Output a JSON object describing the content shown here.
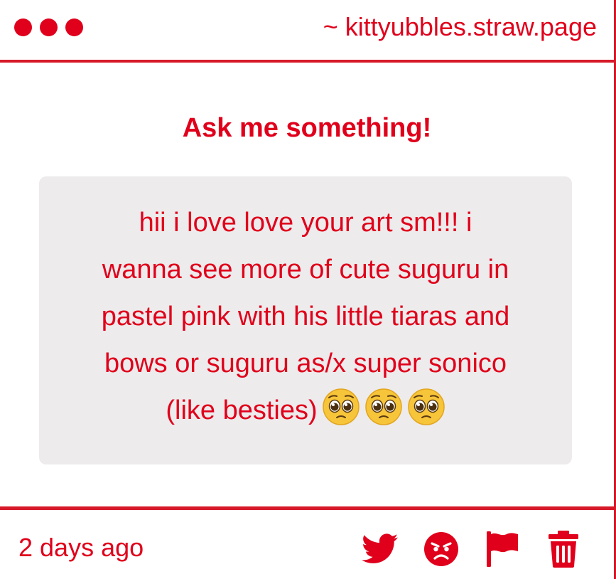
{
  "window": {
    "url_label": "~ kittyubbles.straw.page"
  },
  "main": {
    "heading": "Ask me something!",
    "question_lines": [
      "hii i love love your art sm!!! i",
      "wanna see more of cute suguru in",
      "pastel pink with his little tiaras and",
      "bows or suguru as/x super sonico",
      "(like besties)"
    ],
    "emojis": [
      "pleading-face",
      "pleading-face",
      "pleading-face"
    ]
  },
  "footer": {
    "timestamp": "2 days ago",
    "actions": [
      {
        "icon": "twitter-icon"
      },
      {
        "icon": "angry-face-icon"
      },
      {
        "icon": "flag-icon"
      },
      {
        "icon": "trash-icon"
      }
    ]
  },
  "colors": {
    "accent": "#e0001b",
    "border": "#d61a2a",
    "card_background": "#edebec",
    "page_background": "#ffffff"
  }
}
